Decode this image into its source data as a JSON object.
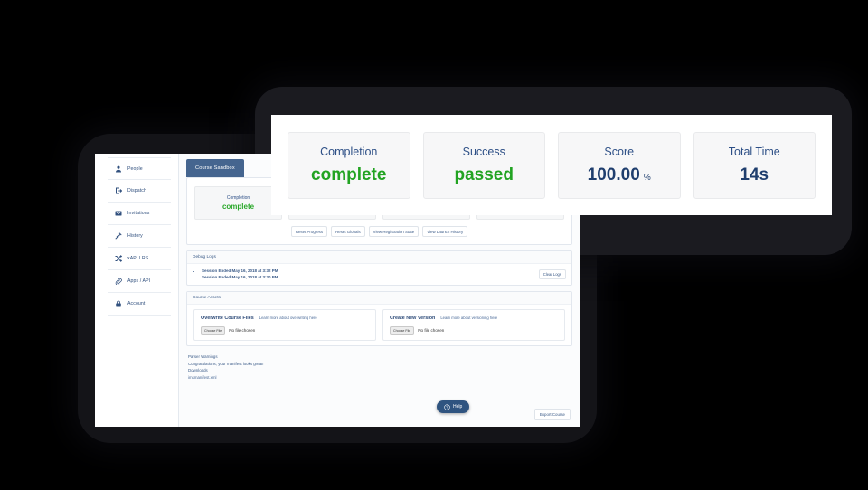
{
  "sidebar": {
    "items": [
      {
        "label": "People",
        "icon": "person-icon"
      },
      {
        "label": "Dispatch",
        "icon": "dispatch-icon"
      },
      {
        "label": "Invitations",
        "icon": "envelope-icon"
      },
      {
        "label": "History",
        "icon": "pin-icon"
      },
      {
        "label": "xAPI LRS",
        "icon": "shuffle-icon"
      },
      {
        "label": "Apps / API",
        "icon": "paperclip-icon"
      },
      {
        "label": "Account",
        "icon": "lock-icon"
      }
    ]
  },
  "tabs": {
    "active": "Course Sandbox"
  },
  "stats": [
    {
      "label": "Completion",
      "value": "complete",
      "suffix": "",
      "color": "#22a322"
    },
    {
      "label": "Success",
      "value": "passed",
      "suffix": "",
      "color": "#22a322"
    },
    {
      "label": "Score",
      "value": "100.00",
      "suffix": "%",
      "color": "#1f3e6e"
    },
    {
      "label": "Total Time",
      "value": "14s",
      "suffix": "",
      "color": "#1f3e6e"
    }
  ],
  "action_buttons": [
    "Reset Progress",
    "Reset Globals",
    "View Registration State",
    "View Launch History"
  ],
  "debug_logs": {
    "title": "Debug Logs",
    "clear_label": "Clear Logs",
    "entries": [
      "Session Ended May 16, 2018 at 3:32 PM",
      "Session Ended May 16, 2018 at 3:30 PM"
    ]
  },
  "course_assets": {
    "title": "Course Assets",
    "cards": [
      {
        "title": "Overwrite Course Files",
        "link": "Learn more about overwriting here",
        "choose_label": "Choose File",
        "file_status": "No file chosen"
      },
      {
        "title": "Create New Version",
        "link": "Learn more about versioning here",
        "choose_label": "Choose File",
        "file_status": "No file chosen"
      }
    ]
  },
  "footer": {
    "parser_warnings_title": "Parser Warnings",
    "parser_warnings_text": "Congratulations, your manifest looks great!",
    "downloads_title": "Downloads",
    "downloads_file": "imsmanifest.xml",
    "export_label": "Export Course"
  },
  "help_widget": {
    "label": "Help",
    "icon": "question-circle-icon",
    "color": "#2f5480"
  },
  "overlay_cards": [
    {
      "label": "Completion",
      "value": "complete",
      "suffix": "",
      "green": true
    },
    {
      "label": "Success",
      "value": "passed",
      "suffix": "",
      "green": true
    },
    {
      "label": "Score",
      "value": "100.00",
      "suffix": "%",
      "green": false
    },
    {
      "label": "Total Time",
      "value": "14s",
      "suffix": "",
      "green": false
    }
  ]
}
